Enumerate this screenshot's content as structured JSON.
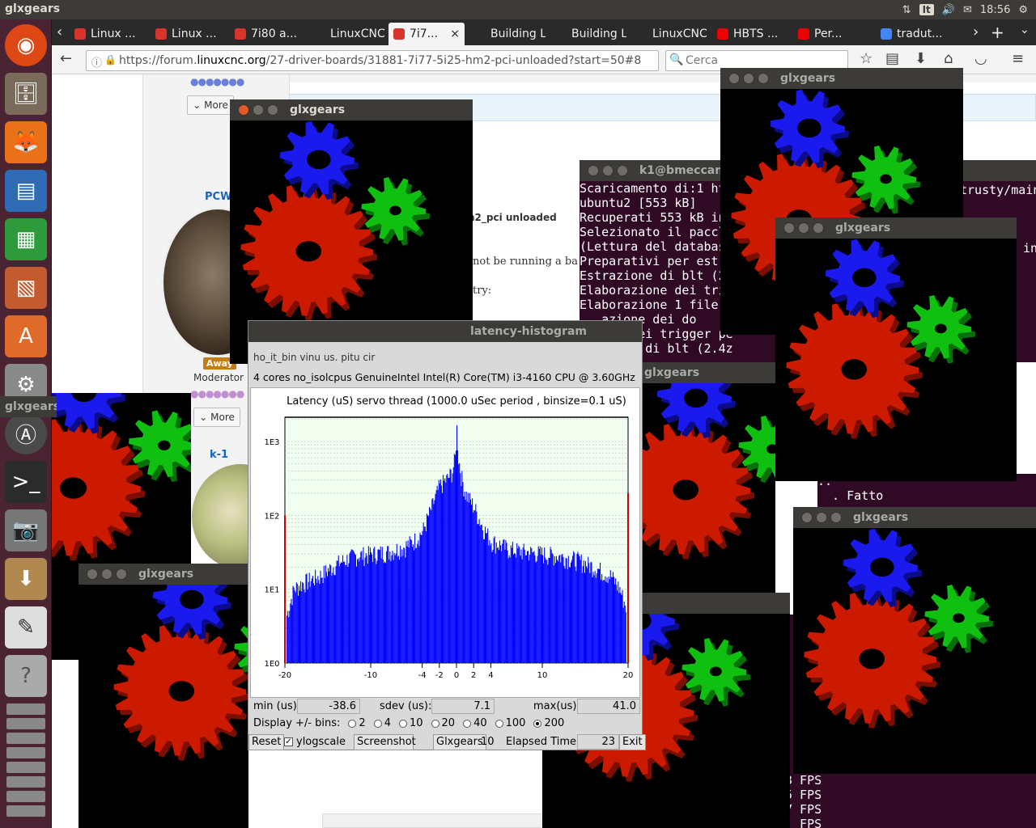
{
  "panel": {
    "title": "glxgears",
    "time": "18:56",
    "lang": "It",
    "vol": "🔊",
    "net": "⇅",
    "mail": "✉"
  },
  "tabs": [
    {
      "label": "Linux ...",
      "color": "#d8342c"
    },
    {
      "label": "Linux ...",
      "color": "#d8342c"
    },
    {
      "label": "7i80 a...",
      "color": "#d8342c"
    },
    {
      "label": "LinuxCNC...",
      "color": ""
    },
    {
      "label": "7i7...",
      "color": "#d8342c"
    },
    {
      "label": "Building L...",
      "color": ""
    },
    {
      "label": "Building L...",
      "color": ""
    },
    {
      "label": "LinuxCNC...",
      "color": ""
    },
    {
      "label": "HBTS ...",
      "color": "#e00"
    },
    {
      "label": "Per...",
      "color": "#e00"
    },
    {
      "label": "tradut...",
      "color": "#4285f4"
    }
  ],
  "url": {
    "prefix": "https://forum.",
    "domain": "linuxcnc.org",
    "path": "/27-driver-boards/31881-7i77-5i25-hm2-pci-unloaded?start=50#8"
  },
  "search_placeholder": "Cerca",
  "forum": {
    "user1": "PCW",
    "status": "Away",
    "role": "Moderator",
    "more": "More",
    "user2": "k-1",
    "topic": "n2_pci unloaded",
    "text1": "not be running a ba",
    "text2": "try:"
  },
  "term1": {
    "title": "k1@bmeccanic",
    "lines": [
      "Scaricamento di:1 ht",
      "ubuntu2 [553 kB]",
      "Recuperati 553 kB in",
      "Selezionato il paccl",
      "(Lettura del databas",
      "Preparativi per estr",
      "Estrazione di blt (2",
      "Elaborazione dei tri",
      "Elaborazione 1 file",
      "   azione dei do",
      "   one dei trigger pe",
      "   zione di blt (2.4z"
    ],
    "right1": "trusty/main",
    "right2": "in"
  },
  "term2": {
    "lines": [
      "..",
      "  . Fatto"
    ]
  },
  "term3": {
    "lines": [
      "3 FPS",
      "5 FPS",
      "7 FPS",
      "  FPS"
    ]
  },
  "gears": [
    {
      "title": "glxgears"
    },
    {
      "title": "glxgears"
    },
    {
      "title": "glxgears"
    },
    {
      "title": "glxgears"
    },
    {
      "title": "glxgears"
    },
    {
      "title": "glxgears"
    },
    {
      "title": "glxgears"
    },
    {
      "title": "rs"
    }
  ],
  "hist": {
    "title": "latency-histogram",
    "info": "4 cores  no_isolcpus   GenuineIntel  Intel(R) Core(TM) i3-4160 CPU @ 3.60GHz",
    "head": "ho_it_bin   vinu us.   pitu   cir",
    "min_label": "min (us)",
    "min": "-38.6",
    "sdev_label": "sdev (us):",
    "sdev": "7.1",
    "max_label": "max(us)",
    "max": "41.0",
    "bins_label": "Display +/- bins:",
    "bins": [
      "2",
      "4",
      "10",
      "20",
      "40",
      "100",
      "200"
    ],
    "bins_selected": "200",
    "reset": "Reset",
    "ylog": "ylogscale",
    "screenshot": "Screenshot",
    "glx": "Glxgears",
    "glx_count": "10",
    "elapsed_label": "Elapsed Time:",
    "elapsed": "23",
    "exit": "Exit"
  },
  "chart_data": {
    "type": "bar",
    "title": "Latency (uS) servo thread (1000.0 uSec period , binsize=0.1 uS)",
    "xlabel": "",
    "ylabel": "",
    "xlim": [
      -20,
      20
    ],
    "ylim": [
      1,
      1000
    ],
    "yscale": "log",
    "xticks": [
      -20,
      -10,
      -4,
      -2,
      0,
      2,
      4,
      10,
      20
    ],
    "yticks": [
      "1E0",
      "1E1",
      "1E2",
      "1E3"
    ],
    "bar_color": "#0000ff",
    "background": "#f0fff0",
    "outline_points": [
      [
        -20,
        100
      ],
      [
        -19.9,
        4
      ],
      [
        -19,
        10
      ],
      [
        -18,
        12
      ],
      [
        -16,
        15
      ],
      [
        -14,
        22
      ],
      [
        -12,
        28
      ],
      [
        -10,
        30
      ],
      [
        -8,
        32
      ],
      [
        -6,
        38
      ],
      [
        -5,
        45
      ],
      [
        -4,
        60
      ],
      [
        -3,
        120
      ],
      [
        -2,
        250
      ],
      [
        -1,
        320
      ],
      [
        -0.5,
        400
      ],
      [
        -0.2,
        600
      ],
      [
        0,
        1500
      ],
      [
        0.2,
        600
      ],
      [
        0.5,
        350
      ],
      [
        1,
        200
      ],
      [
        2,
        130
      ],
      [
        3,
        70
      ],
      [
        4,
        45
      ],
      [
        5,
        40
      ],
      [
        6,
        35
      ],
      [
        8,
        32
      ],
      [
        10,
        30
      ],
      [
        12,
        28
      ],
      [
        14,
        25
      ],
      [
        16,
        20
      ],
      [
        18,
        15
      ],
      [
        19,
        10
      ],
      [
        19.9,
        5
      ],
      [
        20,
        200
      ]
    ],
    "outliers": [
      [
        -20,
        100
      ],
      [
        20,
        200
      ]
    ]
  }
}
